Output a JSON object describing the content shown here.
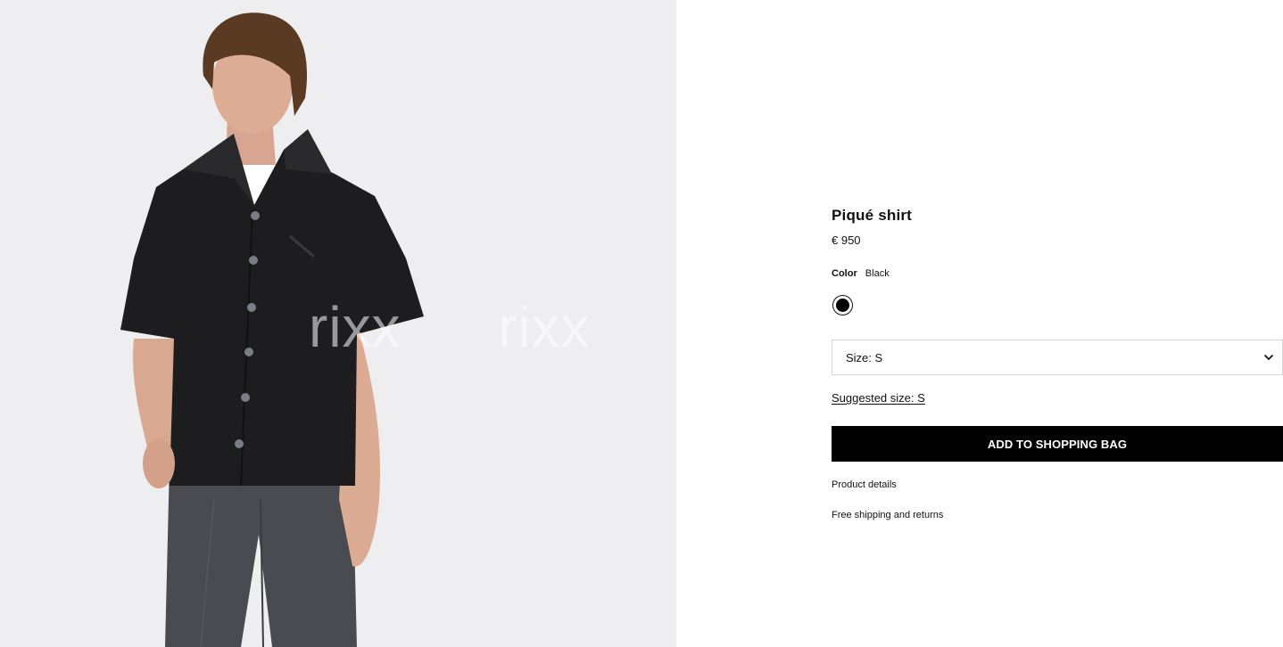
{
  "product": {
    "title": "Piqué shirt",
    "price": "€ 950",
    "image_alt": "Model wearing black short-sleeve piqué shirt with grey trousers"
  },
  "color": {
    "label": "Color",
    "value": "Black",
    "swatch_hex": "#000000"
  },
  "size": {
    "selected": "Size: S",
    "suggested_link": "Suggested size: S"
  },
  "actions": {
    "add_to_bag": "ADD TO SHOPPING BAG",
    "product_details": "Product details",
    "shipping": "Free shipping and returns"
  },
  "watermark": [
    "rixx",
    "rixx"
  ],
  "icons": {
    "size_chevron": "chevron-down-icon"
  }
}
